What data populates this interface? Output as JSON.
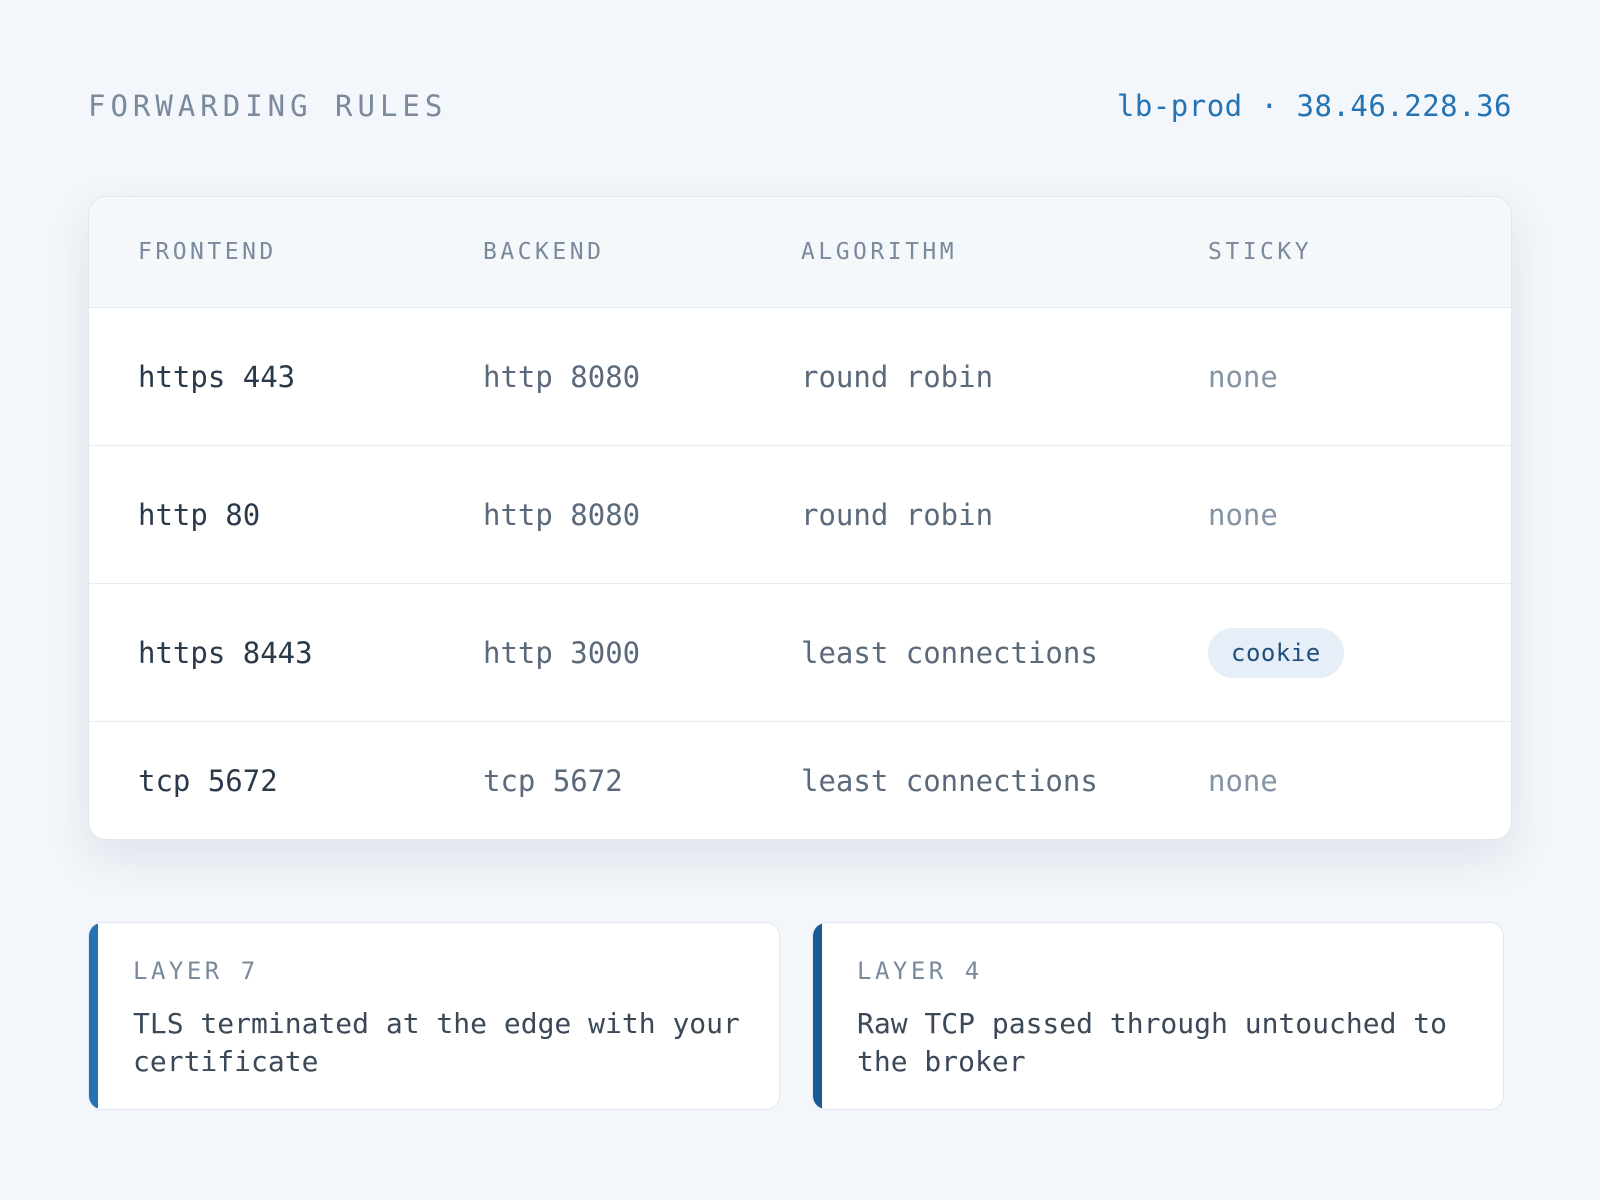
{
  "header": {
    "title": "FORWARDING RULES",
    "lb_info": "lb-prod · 38.46.228.36"
  },
  "table": {
    "columns": [
      "FRONTEND",
      "BACKEND",
      "ALGORITHM",
      "STICKY"
    ],
    "rows": [
      {
        "frontend": "https 443",
        "backend": "http 8080",
        "algorithm": "round robin",
        "sticky": "none",
        "sticky_badge": false
      },
      {
        "frontend": "http 80",
        "backend": "http 8080",
        "algorithm": "round robin",
        "sticky": "none",
        "sticky_badge": false
      },
      {
        "frontend": "https 8443",
        "backend": "http 3000",
        "algorithm": "least connections",
        "sticky": "cookie",
        "sticky_badge": true
      },
      {
        "frontend": "tcp 5672",
        "backend": "tcp 5672",
        "algorithm": "least connections",
        "sticky": "none",
        "sticky_badge": false
      }
    ]
  },
  "notes": [
    {
      "title": "LAYER 7",
      "text": "TLS terminated at the edge with your certificate"
    },
    {
      "title": "LAYER 4",
      "text": "Raw TCP passed through untouched to the broker"
    }
  ],
  "colors": {
    "background": "#f3f6fa",
    "accent": "#2474b5",
    "accent_dark": "#1c5a93",
    "badge_bg": "#e6eef7",
    "badge_text": "#1f4f7d"
  }
}
